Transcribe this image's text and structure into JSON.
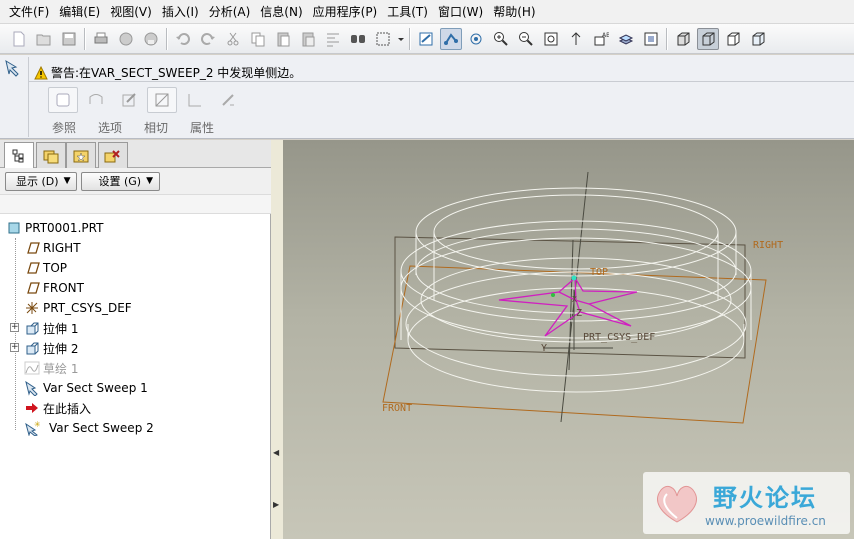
{
  "menu": [
    "文件(F)",
    "编辑(E)",
    "视图(V)",
    "插入(I)",
    "分析(A)",
    "信息(N)",
    "应用程序(P)",
    "工具(T)",
    "窗口(W)",
    "帮助(H)"
  ],
  "toolbar_icons": [
    "new-icon",
    "open-icon",
    "save-icon",
    "print-icon",
    "email-icon",
    "email-link-icon",
    "undo-icon",
    "redo-icon",
    "cut-icon",
    "copy-icon",
    "paste-icon",
    "paste-special-icon",
    "regenerate-icon",
    "find-icon",
    "select-box-icon",
    "repaint-icon",
    "spin-center-icon",
    "orient-mode-icon",
    "zoom-in-icon",
    "zoom-out-icon",
    "refit-icon",
    "reorient-icon",
    "saved-views-icon",
    "layers-icon",
    "view-manager-icon",
    "shading-icon",
    "wireframe-icon",
    "hidden-line-icon",
    "no-hidden-icon"
  ],
  "dashboard": {
    "warning": "警告:在VAR_SECT_SWEEP_2 中发现单侧边。",
    "tabs": [
      "参照",
      "选项",
      "相切",
      "属性"
    ]
  },
  "tree_controls": {
    "display": "显示 (D)",
    "settings": "设置 (G)"
  },
  "tree": {
    "root": "PRT0001.PRT",
    "items": [
      {
        "label": "RIGHT",
        "icon": "datum-plane-icon"
      },
      {
        "label": "TOP",
        "icon": "datum-plane-icon"
      },
      {
        "label": "FRONT",
        "icon": "datum-plane-icon"
      },
      {
        "label": "PRT_CSYS_DEF",
        "icon": "coordinate-system-icon"
      },
      {
        "label": "拉伸 1",
        "icon": "extrude-icon"
      },
      {
        "label": "拉伸 2",
        "icon": "extrude-icon"
      },
      {
        "label": "草绘 1",
        "icon": "sketch-icon"
      },
      {
        "label": "Var Sect Sweep 1",
        "icon": "sweep-icon"
      },
      {
        "label": "在此插入",
        "icon": "insert-here-icon"
      },
      {
        "label": "Var Sect Sweep 2",
        "icon": "sweep-icon"
      }
    ]
  },
  "datum_labels": {
    "right": "RIGHT",
    "top": "TOP",
    "front": "FRONT",
    "csys": "PRT_CSYS_DEF",
    "axis_z": "Z",
    "axis_y": "Y",
    "axis_x": "X"
  },
  "watermark": {
    "title": "野火论坛",
    "url": "www.proewildfire.cn"
  },
  "colors": {
    "datum_plane": "#b06a1e",
    "sketch": "#d020c0",
    "background_top": "#96968a",
    "background_bottom": "#c7c6b8",
    "menu_bg": "#f1f1f1"
  }
}
